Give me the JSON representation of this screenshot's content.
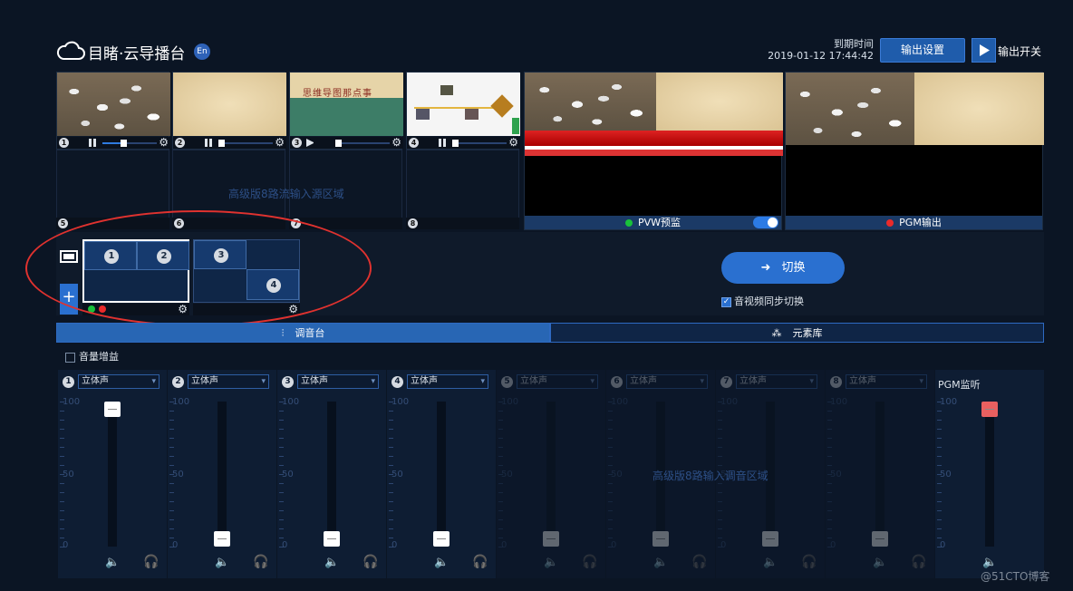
{
  "header": {
    "title": "目睹·云导播台",
    "en_badge": "En",
    "expiry_label": "到期时间",
    "expiry_time": "2019-01-12 17:44:42",
    "settings_button": "输出设置",
    "output_switch_label": "输出开关"
  },
  "sources": [
    {
      "num": "1",
      "slider": 0.38
    },
    {
      "num": "2",
      "slider": 0.0
    },
    {
      "num": "3",
      "slider": 0.0
    },
    {
      "num": "4",
      "slider": 0.0
    }
  ],
  "source3_title": "思维导图那点事",
  "empty_sources": [
    "5",
    "6",
    "7",
    "8"
  ],
  "advanced_source_text": "高级版8路流输入源区域",
  "pvw": {
    "label": "PVW预监",
    "dot_color": "#19c13a"
  },
  "pgm": {
    "label": "PGM输出",
    "dot_color": "#ea2a2a"
  },
  "layouts": [
    {
      "cells": [
        "1",
        "2"
      ]
    },
    {
      "cells": [
        "3",
        "4"
      ]
    }
  ],
  "layout_add": "+",
  "switch_button": "切换",
  "sync_label": "音视频同步切换",
  "tabs": {
    "mixer": "调音台",
    "library": "元素库"
  },
  "gain_label": "音量增益",
  "mixer": {
    "channels": [
      {
        "num": "1",
        "mode": "立体声",
        "level": 1.0
      },
      {
        "num": "2",
        "mode": "立体声",
        "level": 0.0
      },
      {
        "num": "3",
        "mode": "立体声",
        "level": 0.0
      },
      {
        "num": "4",
        "mode": "立体声",
        "level": 0.0
      },
      {
        "num": "5",
        "mode": "立体声",
        "level": 0.0
      },
      {
        "num": "6",
        "mode": "立体声",
        "level": 0.0
      },
      {
        "num": "7",
        "mode": "立体声",
        "level": 0.0
      },
      {
        "num": "8",
        "mode": "立体声",
        "level": 0.0
      }
    ],
    "scale_labels": [
      "100",
      "50",
      "0"
    ],
    "pgm_monitor_label": "PGM监听",
    "pgm_monitor_level": 1.0,
    "advanced_mix_text": "高级版8路输入调音区域"
  },
  "watermark": "@51CTO博客"
}
